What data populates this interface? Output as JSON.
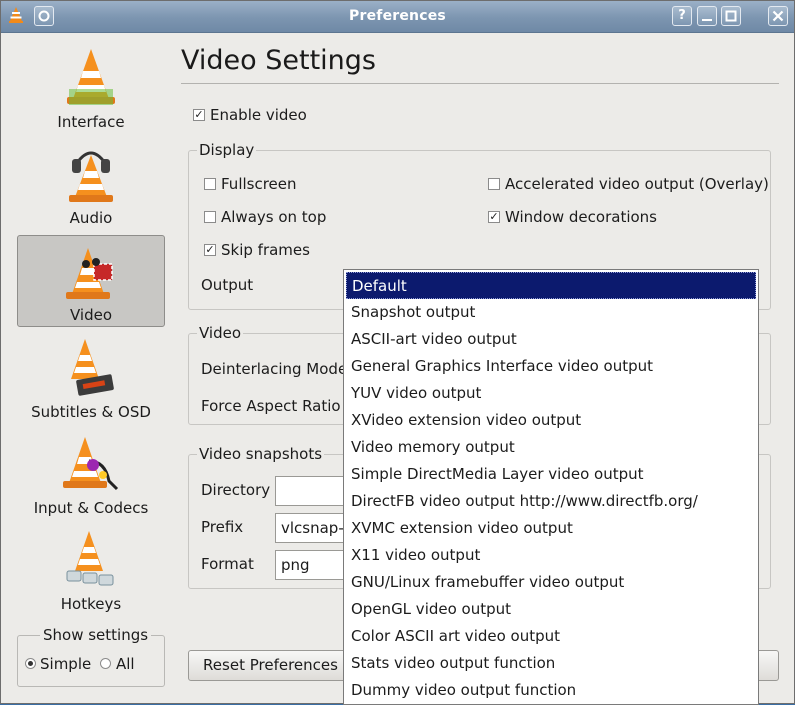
{
  "window": {
    "title": "Preferences"
  },
  "sidebar": {
    "items": [
      {
        "label": "Interface"
      },
      {
        "label": "Audio"
      },
      {
        "label": "Video"
      },
      {
        "label": "Subtitles & OSD"
      },
      {
        "label": "Input & Codecs"
      },
      {
        "label": "Hotkeys"
      }
    ],
    "selected": "Video"
  },
  "show_settings": {
    "title": "Show settings",
    "simple": "Simple",
    "all": "All",
    "selected": "Simple"
  },
  "main": {
    "heading": "Video Settings",
    "enable_video": {
      "label": "Enable video",
      "checked": true
    },
    "display": {
      "title": "Display",
      "fullscreen": {
        "label": "Fullscreen",
        "checked": false
      },
      "always_on_top": {
        "label": "Always on top",
        "checked": false
      },
      "skip_frames": {
        "label": "Skip frames",
        "checked": true
      },
      "accelerated": {
        "label": "Accelerated video output (Overlay)",
        "checked": false
      },
      "window_decorations": {
        "label": "Window decorations",
        "checked": true
      },
      "output_label": "Output"
    },
    "video": {
      "title": "Video",
      "deinterlacing_label": "Deinterlacing Mode",
      "aspect_label": "Force Aspect Ratio"
    },
    "snapshots": {
      "title": "Video snapshots",
      "directory_label": "Directory",
      "directory_value": "",
      "prefix_label": "Prefix",
      "prefix_value": "vlcsnap-",
      "format_label": "Format",
      "format_value": "png"
    },
    "reset_button": "Reset Preferences",
    "output_options": [
      "Default",
      "Snapshot output",
      "ASCII-art video output",
      "General Graphics Interface video output",
      "YUV video output",
      "XVideo extension video output",
      "Video memory output",
      "Simple DirectMedia Layer video output",
      "DirectFB video output http://www.directfb.org/",
      "XVMC extension video output",
      "X11 video output",
      "GNU/Linux framebuffer video output",
      "OpenGL video output",
      "Color ASCII art video output",
      "Stats video output function",
      "Dummy video output function"
    ],
    "output_selected": "Default"
  }
}
